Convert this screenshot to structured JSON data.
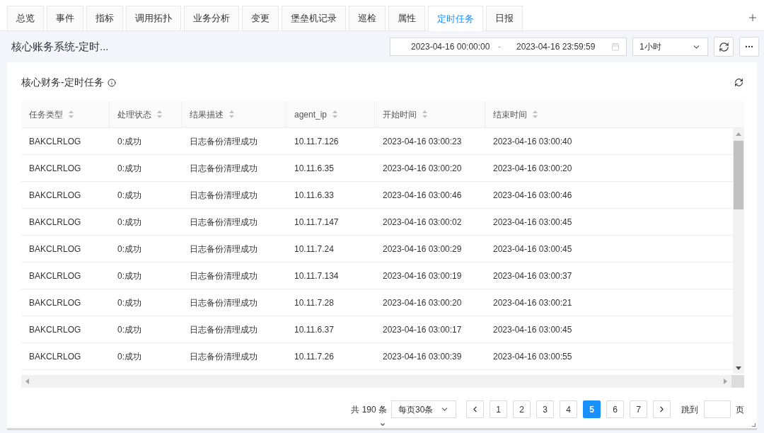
{
  "tabs": [
    {
      "label": "总览",
      "selected": false
    },
    {
      "label": "事件",
      "selected": false
    },
    {
      "label": "指标",
      "selected": false
    },
    {
      "label": "调用拓扑",
      "selected": false
    },
    {
      "label": "业务分析",
      "selected": false
    },
    {
      "label": "变更",
      "selected": false
    },
    {
      "label": "堡垒机记录",
      "selected": false
    },
    {
      "label": "巡检",
      "selected": false
    },
    {
      "label": "属性",
      "selected": false
    },
    {
      "label": "定时任务",
      "selected": true
    },
    {
      "label": "日报",
      "selected": false
    }
  ],
  "header": {
    "title": "核心账务系统-定时...",
    "date_range": {
      "start": "2023-04-16 00:00:00",
      "separator": "-",
      "end": "2023-04-16 23:59:59"
    },
    "interval": {
      "value": "1小时"
    }
  },
  "panel": {
    "title": "核心财务-定时任务",
    "table": {
      "columns": [
        "任务类型",
        "处理状态",
        "结果描述",
        "agent_ip",
        "开始时间",
        "结束时间"
      ],
      "rows": [
        [
          "BAKCLRLOG",
          "0:成功",
          "日志备份清理成功",
          "10.11.7.126",
          "2023-04-16 03:00:23",
          "2023-04-16 03:00:40"
        ],
        [
          "BAKCLRLOG",
          "0:成功",
          "日志备份清理成功",
          "10.11.6.35",
          "2023-04-16 03:00:20",
          "2023-04-16 03:00:20"
        ],
        [
          "BAKCLRLOG",
          "0:成功",
          "日志备份清理成功",
          "10.11.6.33",
          "2023-04-16 03:00:46",
          "2023-04-16 03:00:46"
        ],
        [
          "BAKCLRLOG",
          "0:成功",
          "日志备份清理成功",
          "10.11.7.147",
          "2023-04-16 03:00:02",
          "2023-04-16 03:00:45"
        ],
        [
          "BAKCLRLOG",
          "0:成功",
          "日志备份清理成功",
          "10.11.7.24",
          "2023-04-16 03:00:29",
          "2023-04-16 03:00:45"
        ],
        [
          "BAKCLRLOG",
          "0:成功",
          "日志备份清理成功",
          "10.11.7.134",
          "2023-04-16 03:00:19",
          "2023-04-16 03:00:37"
        ],
        [
          "BAKCLRLOG",
          "0:成功",
          "日志备份清理成功",
          "10.11.7.28",
          "2023-04-16 03:00:20",
          "2023-04-16 03:00:21"
        ],
        [
          "BAKCLRLOG",
          "0:成功",
          "日志备份清理成功",
          "10.11.6.37",
          "2023-04-16 03:00:17",
          "2023-04-16 03:00:45"
        ],
        [
          "BAKCLRLOG",
          "0:成功",
          "日志备份清理成功",
          "10.11.7.26",
          "2023-04-16 03:00:39",
          "2023-04-16 03:00:55"
        ]
      ]
    },
    "pagination": {
      "total": "共 190 条",
      "page_size": {
        "value": "每页30条"
      },
      "pages": [
        {
          "label": "1",
          "selected": false
        },
        {
          "label": "2",
          "selected": false
        },
        {
          "label": "3",
          "selected": false
        },
        {
          "label": "4",
          "selected": false
        },
        {
          "label": "5",
          "selected": true
        },
        {
          "label": "6",
          "selected": false
        },
        {
          "label": "7",
          "selected": false
        }
      ],
      "jump_label": "跳到",
      "jump_unit": "页"
    }
  }
}
